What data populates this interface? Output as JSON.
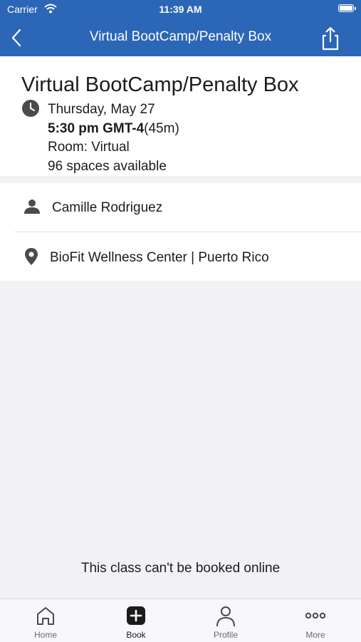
{
  "status_bar": {
    "carrier": "Carrier",
    "time": "11:39 AM"
  },
  "nav": {
    "title": "Virtual BootCamp/Penalty Box",
    "back_icon": "chevron-left-icon",
    "share_icon": "share-icon"
  },
  "class": {
    "title": "Virtual BootCamp/Penalty Box",
    "date": "Thursday, May 27",
    "time": "5:30 pm GMT-4",
    "duration": "(45m)",
    "room": "Room: Virtual",
    "spaces": "96 spaces available"
  },
  "rows": [
    {
      "icon": "person-icon",
      "label": "Camille Rodriguez"
    },
    {
      "icon": "location-pin-icon",
      "label": "BioFit Wellness Center | Puerto Rico"
    }
  ],
  "notice": "This class can't be booked online",
  "tabs": [
    {
      "icon": "home-icon",
      "label": "Home",
      "active": false
    },
    {
      "icon": "add-square-icon",
      "label": "Book",
      "active": true
    },
    {
      "icon": "profile-icon",
      "label": "Profile",
      "active": false
    },
    {
      "icon": "more-dots-icon",
      "label": "More",
      "active": false
    }
  ],
  "colors": {
    "brand": "#2c66b6",
    "background": "#f2f2f4",
    "text": "#1c1c1e",
    "icon": "#4a4a4f"
  }
}
